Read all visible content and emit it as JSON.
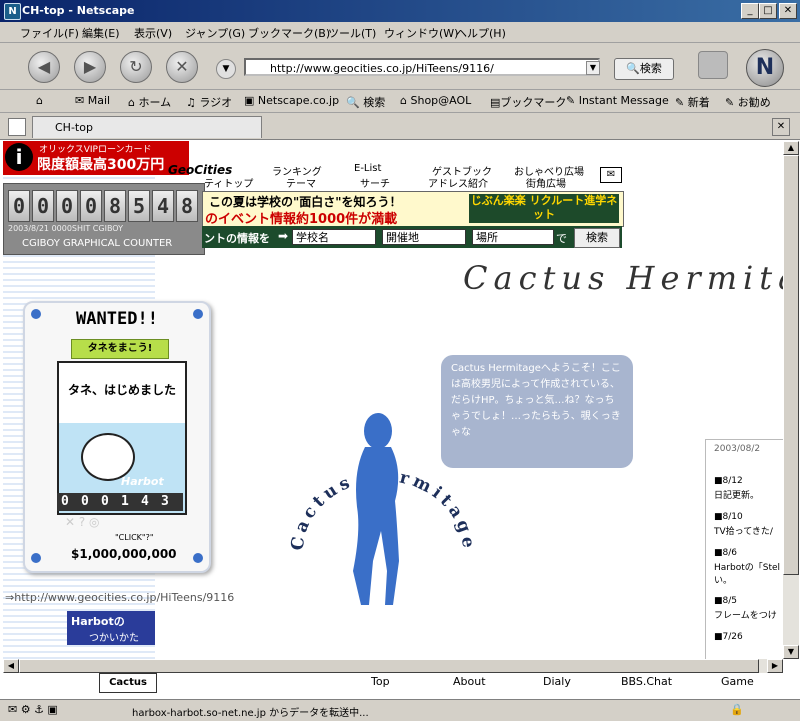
{
  "window": {
    "title": "CH-top - Netscape",
    "app_icon": "N"
  },
  "menu": [
    "ファイル(F)",
    "編集(E)",
    "表示(V)",
    "ジャンプ(G)",
    "ブックマーク(B)",
    "ツール(T)",
    "ウィンドウ(W)",
    "ヘルプ(H)"
  ],
  "nav": {
    "url": "http://www.geocities.co.jp/HiTeens/9116/",
    "search_label": "検索",
    "logo": "N"
  },
  "bookmarks": [
    "Mail",
    "ホーム",
    "ラジオ",
    "Netscape.co.jp",
    "検索",
    "Shop@AOL",
    "ブックマーク",
    "Instant Message",
    "新着",
    "お勧め"
  ],
  "tab": {
    "label": "CH-top"
  },
  "ads": {
    "orix_line1": "オリックスVIPローンカード",
    "orix_line2": "限度額最高300万円",
    "counter_digits": [
      "0",
      "0",
      "0",
      "0",
      "8",
      "5",
      "4",
      "8"
    ],
    "counter_caption": "2003/8/21  0000SHIT  CGIBOY",
    "counter_footer": "CGIBOY GRAPHICAL COUNTER"
  },
  "geocities": {
    "logo": "GeoCities",
    "links_row1": [
      "ランキング",
      "E-List",
      "ゲストブック",
      "おしゃべり広場"
    ],
    "links_row2": [
      "ティトップ",
      "テーマ",
      "サーチ",
      "アドレス紹介",
      "街角広場"
    ],
    "banner_line1": "この夏は学校の\"面白さ\"を知ろう！",
    "banner_line2": "のイベント情報約1000件が満載",
    "banner_logo": "じぶん楽楽 リクルート進学ネット",
    "search_prefix": "ントの情報を",
    "select_school": "学校名",
    "select_place": "開催地",
    "select_area": "場所",
    "search_suffix": "で",
    "search_button": "検索"
  },
  "site": {
    "title": "Cactus Hermitage",
    "circle_text": "Cactus Hermitage",
    "bubble_text": "Cactus Hermitageへようこそ！ここは高校男児によって作成されている、だらけHP。ちょっと気…ね？なっちゃうでしょ！…ったらもう、覗くっきゃな",
    "url_text": "⇒http://www.geocities.co.jp/HiTeens/9116"
  },
  "wanted": {
    "title": "WANTED!!",
    "tag": "タネをまこう!",
    "caption": "タネ、はじめました",
    "brand": "Harbot",
    "digits": [
      "0",
      "0",
      "0",
      "1",
      "4",
      "3"
    ],
    "click": "\"CLICK\"?\"",
    "bounty": "$1,000,000,000",
    "harbot_ad_line1": "Harbotの",
    "harbot_ad_line2": "つかいかた"
  },
  "news": {
    "header": "2003/08/2",
    "items": [
      {
        "date": "■8/12",
        "text": "日記更新。"
      },
      {
        "date": "■8/10",
        "text": "TV拾ってきた/"
      },
      {
        "date": "■8/6",
        "text": "Harbotの「Stel さい。"
      },
      {
        "date": "■8/5",
        "text": "フレームをつけ"
      },
      {
        "date": "■7/26",
        "text": ""
      }
    ]
  },
  "bottom_nav": [
    "Top",
    "About",
    "Dialy",
    "BBS.Chat",
    "Game"
  ],
  "status": {
    "text": "harbox-harbot.so-net.ne.jp からデータを転送中..."
  },
  "colors": {
    "accent": "#0a246a",
    "chrome": "#d4d0c8",
    "silhouette": "#3a6fc8",
    "bubble": "#a8b5cf"
  }
}
